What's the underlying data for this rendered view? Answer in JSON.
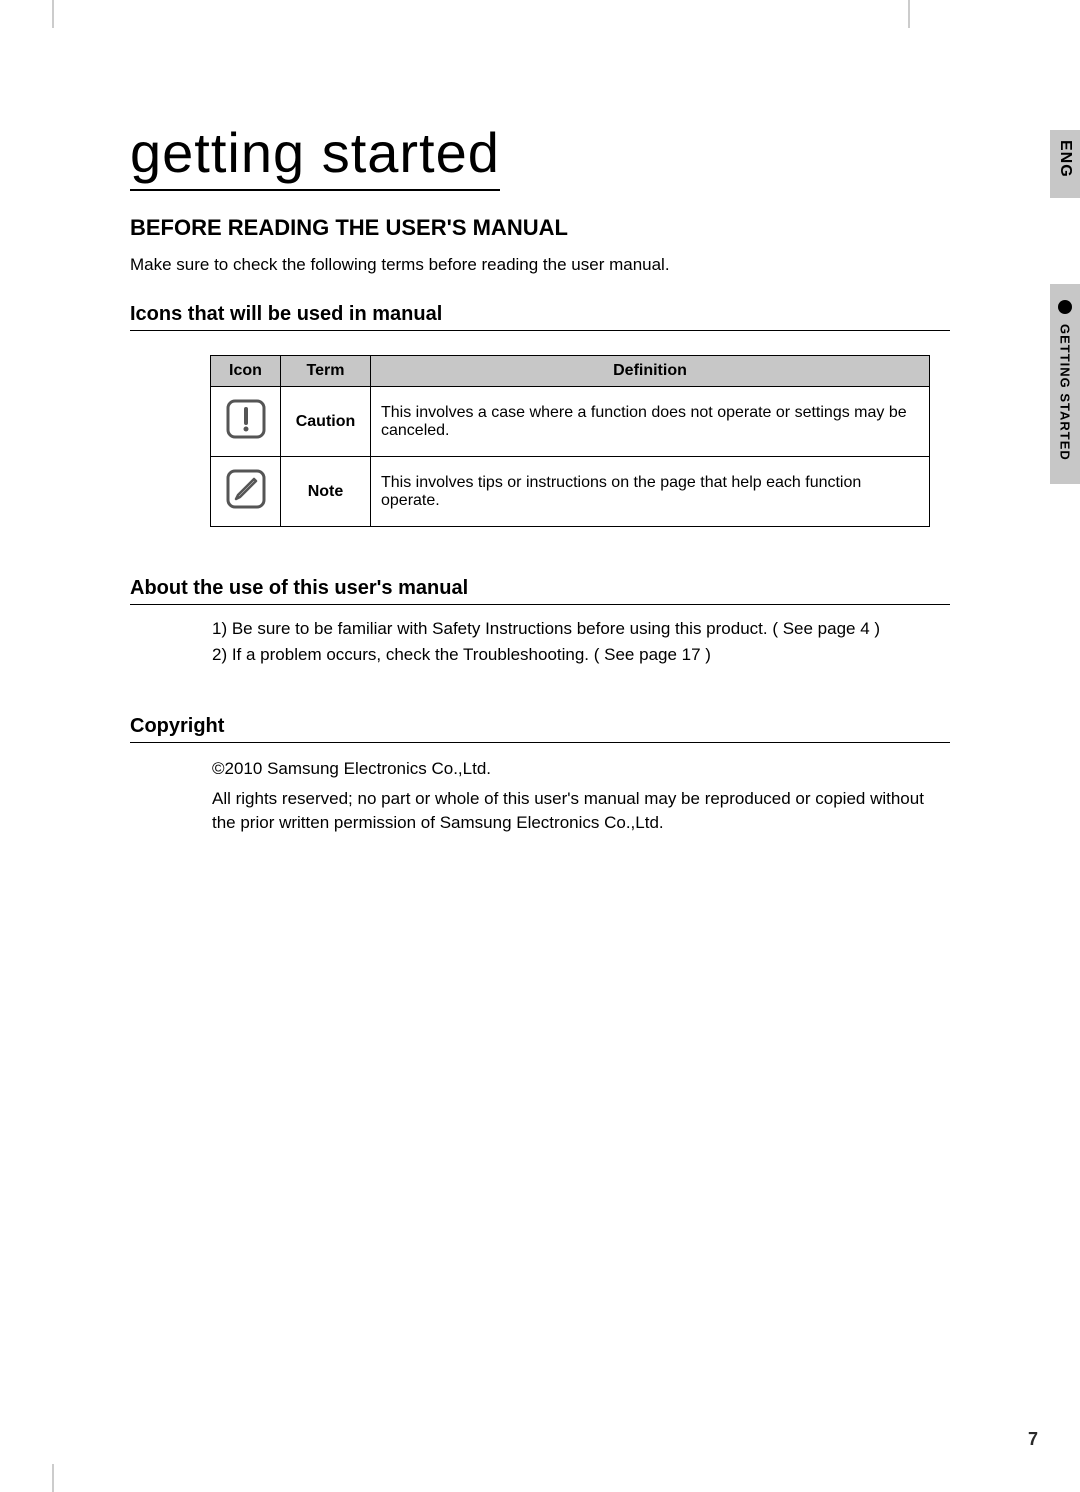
{
  "sideLang": "ENG",
  "sideTab": "GETTING STARTED",
  "chapterTitle": "getting started",
  "sectionTitle": "BEFORE READING THE USER'S MANUAL",
  "introText": "Make sure to check the following terms before reading the user manual.",
  "iconsSection": {
    "heading": "Icons that will be used in manual",
    "headers": {
      "icon": "Icon",
      "term": "Term",
      "definition": "Definition"
    },
    "rows": [
      {
        "iconName": "caution-icon",
        "term": "Caution",
        "definition": "This involves a case where a function does not operate or settings may be canceled."
      },
      {
        "iconName": "note-icon",
        "term": "Note",
        "definition": "This involves tips or instructions on the page that help each function operate."
      }
    ]
  },
  "aboutSection": {
    "heading": "About the use of this user's manual",
    "items": [
      "1)  Be sure to be familiar with Safety Instructions before using this product. ( See page 4 )",
      "2)  If a problem occurs, check the Troubleshooting. ( See page 17 )"
    ]
  },
  "copyrightSection": {
    "heading": "Copyright",
    "line1": "©2010 Samsung Electronics Co.,Ltd.",
    "line2": "All rights reserved; no part or whole of this user's manual may be reproduced or copied without the prior written permission of Samsung Electronics Co.,Ltd."
  },
  "pageNumber": "7"
}
